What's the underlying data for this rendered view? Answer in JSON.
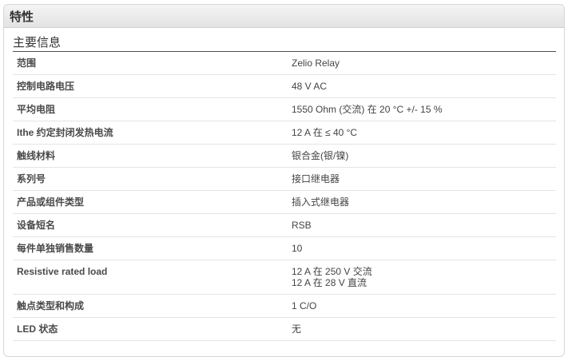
{
  "panel": {
    "header": "特性",
    "section_title": "主要信息"
  },
  "rows": [
    {
      "label": "范围",
      "value": [
        "Zelio Relay"
      ]
    },
    {
      "label": "控制电路电压",
      "value": [
        "48 V AC"
      ]
    },
    {
      "label": "平均电阻",
      "value": [
        "1550 Ohm (交流) 在 20 °C +/- 15 %"
      ]
    },
    {
      "label": "Ithe 约定封闭发热电流",
      "value": [
        "12 A 在 ≤ 40 °C"
      ]
    },
    {
      "label": "触线材料",
      "value": [
        "银合金(银/镍)"
      ]
    },
    {
      "label": "系列号",
      "value": [
        "接口继电器"
      ]
    },
    {
      "label": "产品或组件类型",
      "value": [
        "插入式继电器"
      ]
    },
    {
      "label": "设备短名",
      "value": [
        "RSB"
      ]
    },
    {
      "label": "每件单独销售数量",
      "value": [
        "10"
      ]
    },
    {
      "label": "Resistive rated load",
      "value": [
        "12 A 在 250 V 交流",
        "12 A 在 28 V 直流"
      ]
    },
    {
      "label": "触点类型和构成",
      "value": [
        "1 C/O"
      ]
    },
    {
      "label": "LED 状态",
      "value": [
        "无"
      ]
    }
  ]
}
